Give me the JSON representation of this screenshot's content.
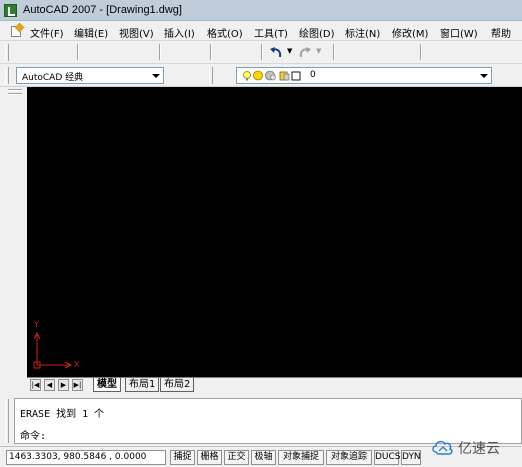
{
  "window": {
    "title": "AutoCAD 2007 - [Drawing1.dwg]"
  },
  "menu": [
    {
      "label": "文件(F)"
    },
    {
      "label": "编辑(E)"
    },
    {
      "label": "视图(V)"
    },
    {
      "label": "插入(I)"
    },
    {
      "label": "格式(O)"
    },
    {
      "label": "工具(T)"
    },
    {
      "label": "绘图(D)"
    },
    {
      "label": "标注(N)"
    },
    {
      "label": "修改(M)"
    },
    {
      "label": "窗口(W)"
    },
    {
      "label": "帮助"
    }
  ],
  "workspace": {
    "selected": "AutoCAD 经典"
  },
  "layer": {
    "selected": "0"
  },
  "ucs": {
    "y_label": "Y",
    "x_label": "X"
  },
  "tabs": [
    {
      "label": "模型",
      "active": true
    },
    {
      "label": "布局1",
      "active": false
    },
    {
      "label": "布局2",
      "active": false
    }
  ],
  "command": {
    "history": "ERASE 找到 1 个",
    "prompt": "命令:"
  },
  "status": {
    "coords": "1463.3303, 980.5846 , 0.0000",
    "buttons": [
      "捕捉",
      "栅格",
      "正交",
      "极轴",
      "对象捕捉",
      "对象追踪",
      "DUCS",
      "DYN"
    ]
  },
  "watermark": {
    "text": "亿速云"
  },
  "colors": {
    "canvas": "#000000",
    "ucs": "#d02020",
    "titlebar": "#bfcddb"
  }
}
